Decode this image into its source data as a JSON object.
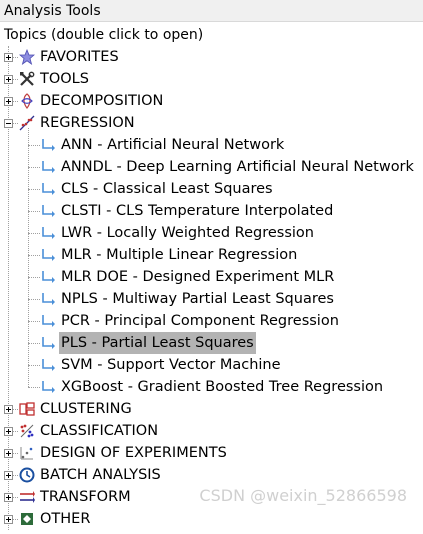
{
  "window": {
    "title": "Analysis Tools"
  },
  "tree_header": "Topics (double click to open)",
  "topics": [
    {
      "label": "FAVORITES",
      "icon": "star-icon",
      "expanded": false
    },
    {
      "label": "TOOLS",
      "icon": "tools-icon",
      "expanded": false
    },
    {
      "label": "DECOMPOSITION",
      "icon": "decomposition-icon",
      "expanded": false
    },
    {
      "label": "REGRESSION",
      "icon": "regression-icon",
      "expanded": true,
      "children": [
        "ANN - Artificial Neural Network",
        "ANNDL - Deep Learning Artificial Neural Network",
        "CLS - Classical Least Squares",
        "CLSTI - CLS Temperature Interpolated",
        "LWR - Locally Weighted Regression",
        "MLR - Multiple Linear Regression",
        "MLR DOE - Designed Experiment MLR",
        "NPLS - Multiway Partial Least Squares",
        "PCR - Principal Component Regression",
        "PLS - Partial Least Squares",
        "SVM - Support Vector Machine",
        "XGBoost - Gradient Boosted Tree Regression"
      ],
      "selected_child": "PLS - Partial Least Squares"
    },
    {
      "label": "CLUSTERING",
      "icon": "clustering-icon",
      "expanded": false
    },
    {
      "label": "CLASSIFICATION",
      "icon": "classification-icon",
      "expanded": false
    },
    {
      "label": "DESIGN OF EXPERIMENTS",
      "icon": "doe-icon",
      "expanded": false
    },
    {
      "label": "BATCH ANALYSIS",
      "icon": "batch-icon",
      "expanded": false
    },
    {
      "label": "TRANSFORM",
      "icon": "transform-icon",
      "expanded": false
    },
    {
      "label": "OTHER",
      "icon": "other-icon",
      "expanded": false
    }
  ],
  "watermark": "CSDN @weixin_52866598"
}
